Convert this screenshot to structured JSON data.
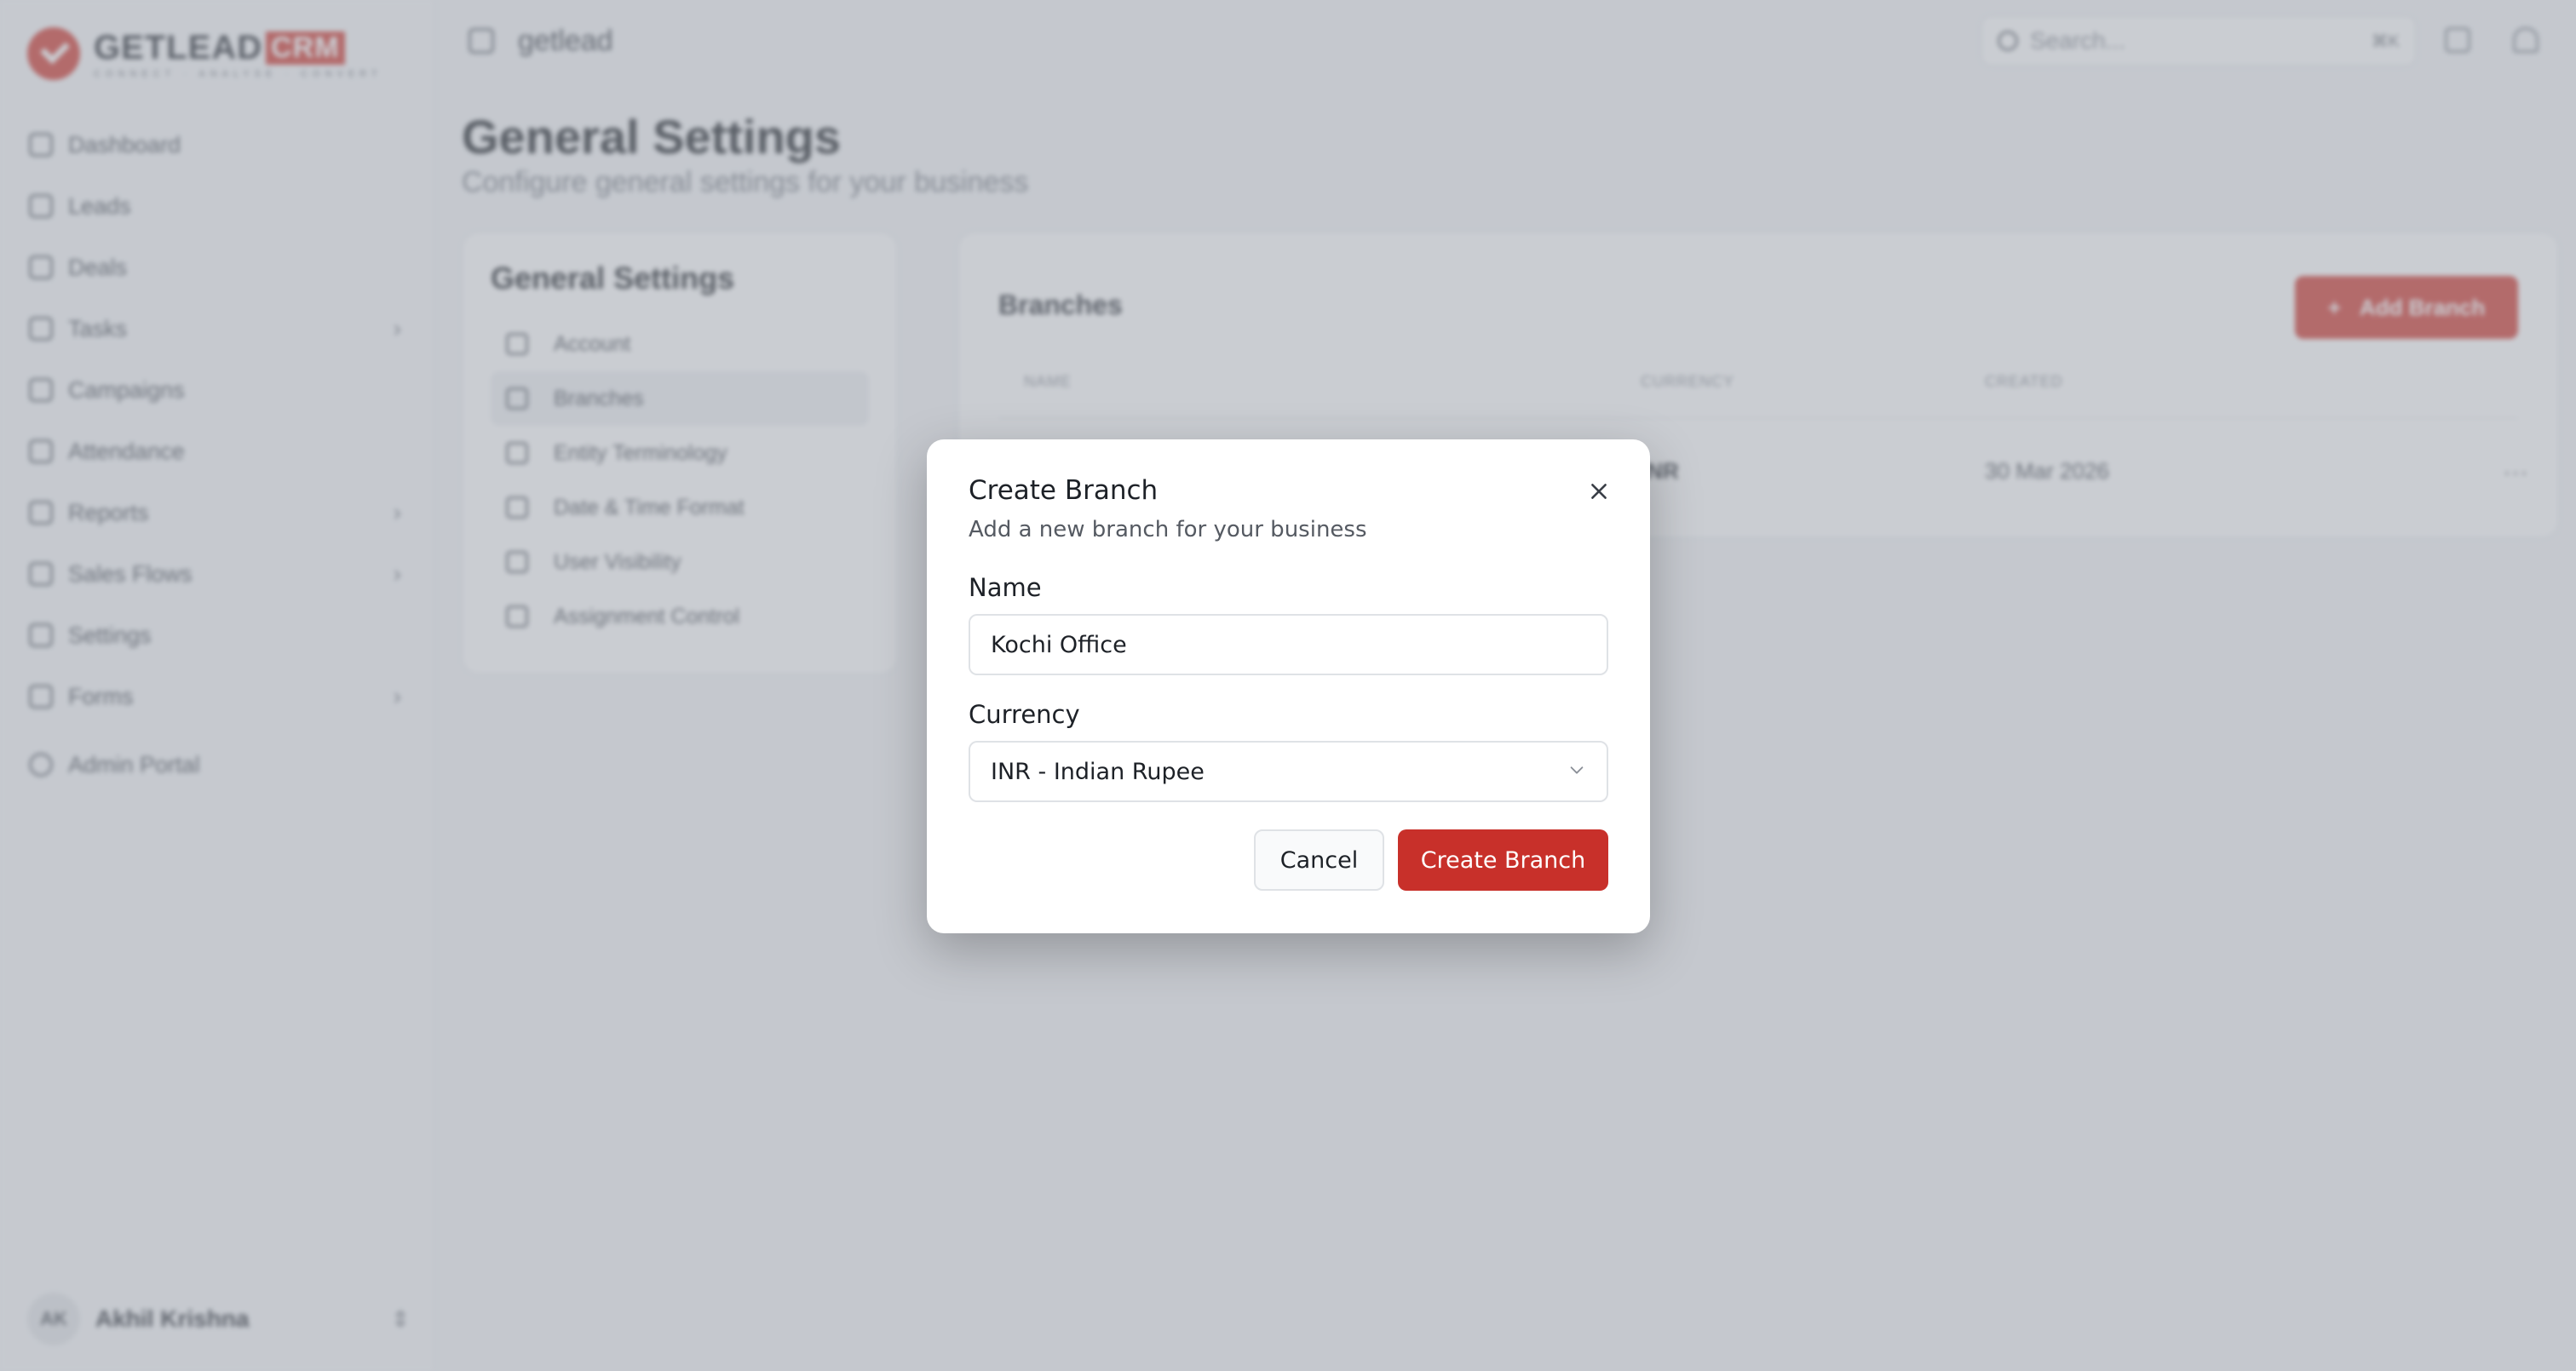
{
  "brand": {
    "word": "GETLEAD",
    "crm": "CRM",
    "tagline": "CONNECT · ANALYSE · CONVERT",
    "accent": "#d13a31"
  },
  "sidebar": {
    "items": [
      {
        "label": "Dashboard",
        "icon": "dashboard-icon",
        "has_children": false
      },
      {
        "label": "Leads",
        "icon": "users-icon",
        "has_children": false
      },
      {
        "label": "Deals",
        "icon": "dollar-icon",
        "has_children": false
      },
      {
        "label": "Tasks",
        "icon": "clipboard-icon",
        "has_children": true
      },
      {
        "label": "Campaigns",
        "icon": "megaphone-icon",
        "has_children": false
      },
      {
        "label": "Attendance",
        "icon": "calendar-icon",
        "has_children": false
      },
      {
        "label": "Reports",
        "icon": "bar-chart-icon",
        "has_children": true
      },
      {
        "label": "Sales Flows",
        "icon": "git-branch-icon",
        "has_children": true
      },
      {
        "label": "Settings",
        "icon": "gear-icon",
        "has_children": false
      },
      {
        "label": "Forms",
        "icon": "file-icon",
        "has_children": true
      }
    ],
    "admin_label": "Admin Portal",
    "user": {
      "initials": "AK",
      "name": "Akhil Krishna"
    }
  },
  "topbar": {
    "org": "getlead",
    "search_placeholder": "Search...",
    "shortcut": "⌘K"
  },
  "page": {
    "title": "General Settings",
    "subtitle": "Configure general settings for your business"
  },
  "settings_nav": {
    "title": "General Settings",
    "items": [
      {
        "label": "Account",
        "icon": "building-icon",
        "active": false
      },
      {
        "label": "Branches",
        "icon": "git-branch-icon",
        "active": true
      },
      {
        "label": "Entity Terminology",
        "icon": "translate-icon",
        "active": false
      },
      {
        "label": "Date & Time Format",
        "icon": "calendar-icon",
        "active": false
      },
      {
        "label": "User Visibility",
        "icon": "users-icon",
        "active": false
      },
      {
        "label": "Assignment Control",
        "icon": "user-check-icon",
        "active": false
      }
    ]
  },
  "branches": {
    "title": "Branches",
    "add_label": "Add Branch",
    "columns": [
      "NAME",
      "CURRENCY",
      "CREATED"
    ],
    "rows": [
      {
        "name": "",
        "currency": "INR",
        "created": "30 Mar 2026"
      }
    ]
  },
  "modal": {
    "title": "Create Branch",
    "description": "Add a new branch for your business",
    "name_label": "Name",
    "name_value": "Kochi Office",
    "currency_label": "Currency",
    "currency_value": "INR - Indian Rupee",
    "cancel_label": "Cancel",
    "submit_label": "Create Branch",
    "submit_color": "#c8302a"
  }
}
